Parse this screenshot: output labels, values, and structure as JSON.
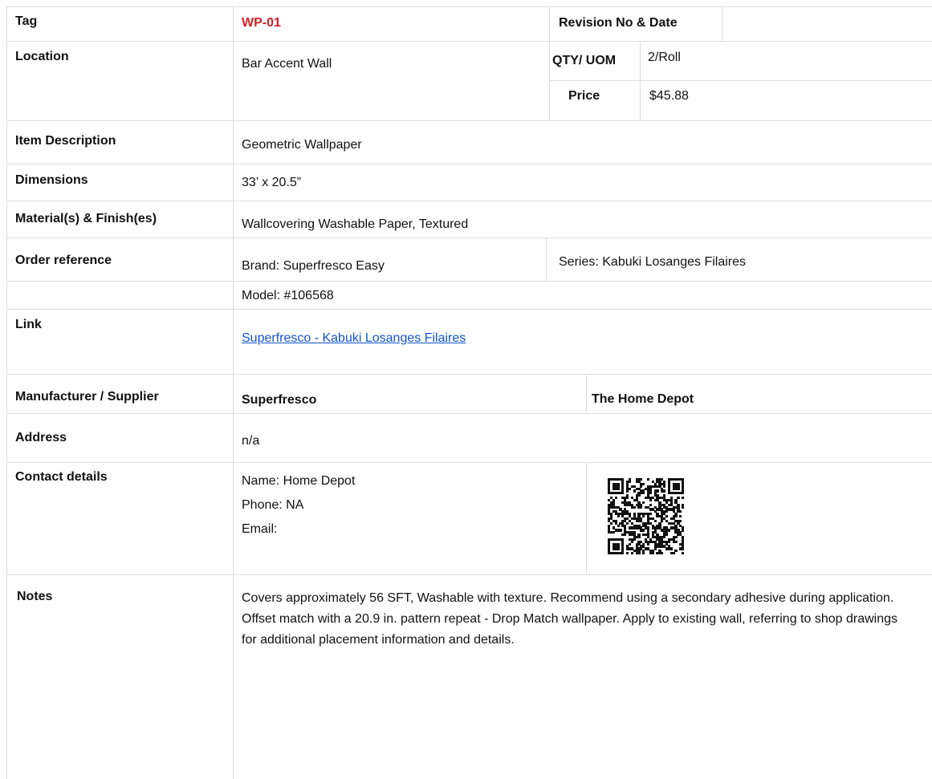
{
  "tag": {
    "label": "Tag",
    "value": "WP-01"
  },
  "revision": {
    "label": "Revision No & Date",
    "value": ""
  },
  "location": {
    "label": "Location",
    "value": "Bar Accent Wall"
  },
  "qty": {
    "label": "QTY/ UOM",
    "value": "2/Roll"
  },
  "price": {
    "label": "Price",
    "value": "$45.88"
  },
  "item_description": {
    "label": "Item Description",
    "value": "Geometric Wallpaper"
  },
  "dimensions": {
    "label": "Dimensions",
    "value": "33’ x 20.5”"
  },
  "materials": {
    "label": "Material(s) & Finish(es)",
    "value": "Wallcovering Washable Paper, Textured"
  },
  "order_reference": {
    "label": "Order reference",
    "brand": "Brand: Superfresco Easy",
    "series": "Series: Kabuki Losanges Filaires",
    "model": "Model: #106568"
  },
  "link": {
    "label": "Link",
    "text": "Superfresco - Kabuki Losanges Filaires"
  },
  "manufacturer": {
    "label": "Manufacturer / Supplier",
    "manufacturer": "Superfresco",
    "supplier": "The Home Depot"
  },
  "address": {
    "label": "Address",
    "value": "n/a"
  },
  "contact": {
    "label": "Contact details",
    "name": "Name:  Home Depot",
    "phone": "Phone: NA",
    "email": "Email:"
  },
  "notes": {
    "label": "Notes",
    "text": "Covers approximately 56 SFT, Washable with texture. Recommend using a secondary adhesive during application. Offset match with a 20.9 in. pattern repeat - Drop Match wallpaper. Apply to existing wall, referring to shop drawings for additional placement information and details."
  },
  "colors": {
    "tag_red": "#d0202a",
    "link_blue": "#1155cc",
    "grid": "#dcdcdc"
  }
}
